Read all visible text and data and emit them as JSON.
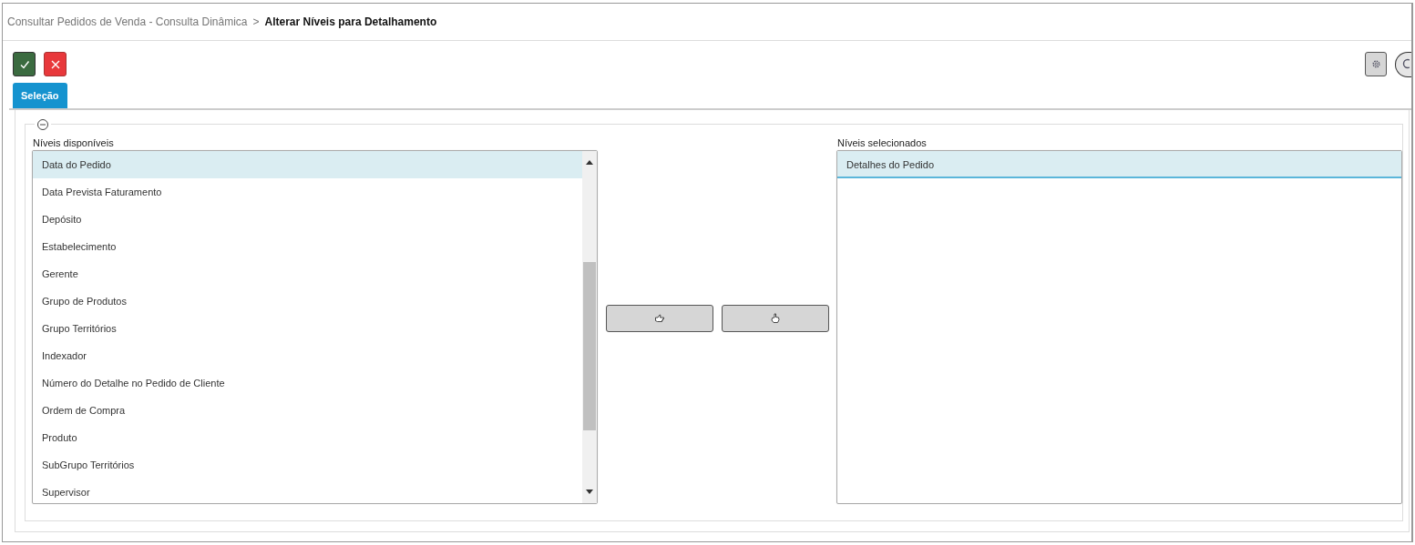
{
  "breadcrumb": [
    {
      "label": "Consultar Pedidos de Venda - Consulta Dinâmica",
      "current": false
    },
    {
      "label": "Alterar Níveis para Detalhamento",
      "current": true
    }
  ],
  "breadcrumb_separator": ">",
  "tabs": [
    {
      "label": "Seleção",
      "selected": true
    }
  ],
  "lists": [
    {
      "label": "Níveis disponíveis",
      "scrollable": true,
      "items": [
        {
          "label": "Data do Pedido",
          "selected": true
        },
        {
          "label": "Data Prevista Faturamento",
          "selected": false
        },
        {
          "label": "Depósito",
          "selected": false
        },
        {
          "label": "Estabelecimento",
          "selected": false
        },
        {
          "label": "Gerente",
          "selected": false
        },
        {
          "label": "Grupo de Produtos",
          "selected": false
        },
        {
          "label": "Grupo Territórios",
          "selected": false
        },
        {
          "label": "Indexador",
          "selected": false
        },
        {
          "label": "Número do Detalhe no Pedido de Cliente",
          "selected": false
        },
        {
          "label": "Ordem de Compra",
          "selected": false
        },
        {
          "label": "Produto",
          "selected": false
        },
        {
          "label": "SubGrupo Territórios",
          "selected": false
        },
        {
          "label": "Supervisor",
          "selected": false
        }
      ]
    },
    {
      "label": "Níveis selecionados",
      "scrollable": false,
      "items": [
        {
          "label": "Detalhes do Pedido",
          "selected": true
        }
      ]
    }
  ]
}
